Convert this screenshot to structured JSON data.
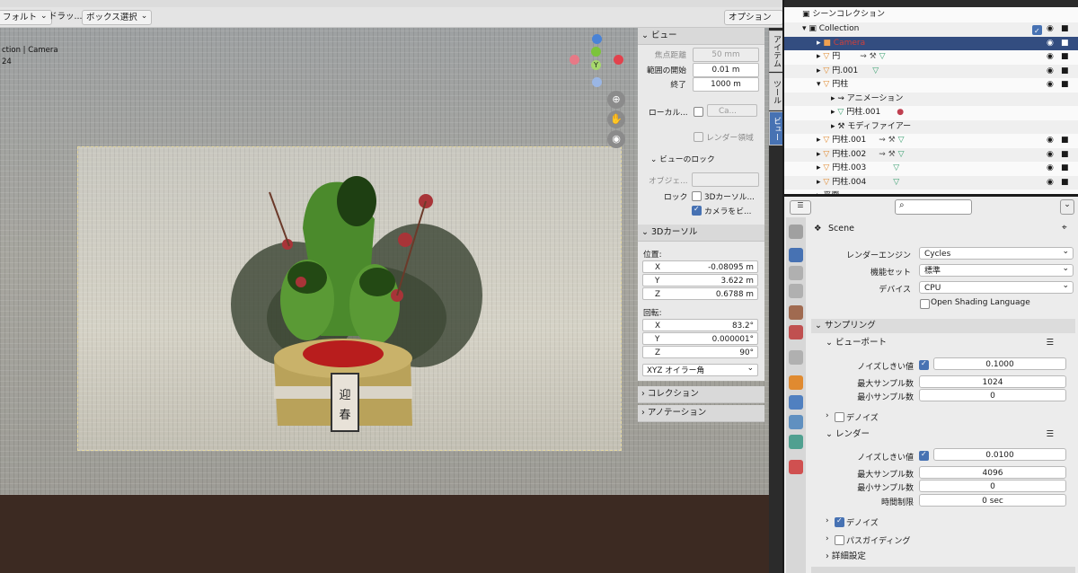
{
  "header": {
    "mode_dropdown": "フォルト",
    "drag_label": "ドラッ...",
    "select_mode": "ボックス選択",
    "options": "オプション"
  },
  "viewport": {
    "label": "ction | Camera",
    "label2": "24",
    "gizmo_axis": "Y"
  },
  "npanel": {
    "view_header": "ビュー",
    "focal_label": "焦点距離",
    "focal_value": "50 mm",
    "clip_start_label": "範囲の開始",
    "clip_start_value": "0.01 m",
    "clip_end_label": "終了",
    "clip_end_value": "1000 m",
    "local_label": "ローカル...",
    "local_value": "Ca...",
    "render_region": "レンダー領域",
    "view_lock_header": "ビューのロック",
    "object_label": "オブジェ...",
    "lock_label": "ロック",
    "lock_cursor": "3Dカーソル...",
    "lock_camera": "カメラをビ...",
    "cursor_header": "3Dカーソル",
    "location_label": "位置:",
    "x_label": "X",
    "x_value": "-0.08095 m",
    "y_label": "Y",
    "y_value": "3.622 m",
    "z_label": "Z",
    "z_value": "0.6788 m",
    "rotation_label": "回転:",
    "rx_value": "83.2°",
    "ry_value": "0.000001°",
    "rz_value": "90°",
    "rot_mode": "XYZ オイラー角",
    "collection_header": "コレクション",
    "annotation_header": "アノテーション"
  },
  "tabs": [
    "アイテム",
    "ツール",
    "ビュー"
  ],
  "outliner": {
    "scene_collection": "シーンコレクション",
    "rows": [
      {
        "name": "Collection"
      },
      {
        "name": "Camera"
      },
      {
        "name": "円"
      },
      {
        "name": "円.001"
      },
      {
        "name": "円柱"
      },
      {
        "name": "アニメーション"
      },
      {
        "name": "円柱.001"
      },
      {
        "name": "モディファイアー"
      },
      {
        "name": "円柱.001"
      },
      {
        "name": "円柱.002"
      },
      {
        "name": "円柱.003"
      },
      {
        "name": "円柱.004"
      },
      {
        "name": "平面"
      }
    ]
  },
  "props": {
    "scene_name": "Scene",
    "render_engine_label": "レンダーエンジン",
    "render_engine_value": "Cycles",
    "feature_set_label": "機能セット",
    "feature_set_value": "標準",
    "device_label": "デバイス",
    "device_value": "CPU",
    "osl_label": "Open Shading Language",
    "sampling_header": "サンプリング",
    "viewport_header": "ビューポート",
    "vp_noise_label": "ノイズしきい値",
    "vp_noise_value": "0.1000",
    "vp_max_label": "最大サンプル数",
    "vp_max_value": "1024",
    "vp_min_label": "最小サンプル数",
    "vp_min_value": "0",
    "vp_denoise": "デノイズ",
    "render_header": "レンダー",
    "r_noise_label": "ノイズしきい値",
    "r_noise_value": "0.0100",
    "r_max_label": "最大サンプル数",
    "r_max_value": "4096",
    "r_min_label": "最小サンプル数",
    "r_min_value": "0",
    "r_time_label": "時間制限",
    "r_time_value": "0 sec",
    "r_denoise": "デノイズ",
    "path_guiding": "パスガイディング",
    "advanced": "詳細設定"
  },
  "kadomatsu_label": "迎春"
}
